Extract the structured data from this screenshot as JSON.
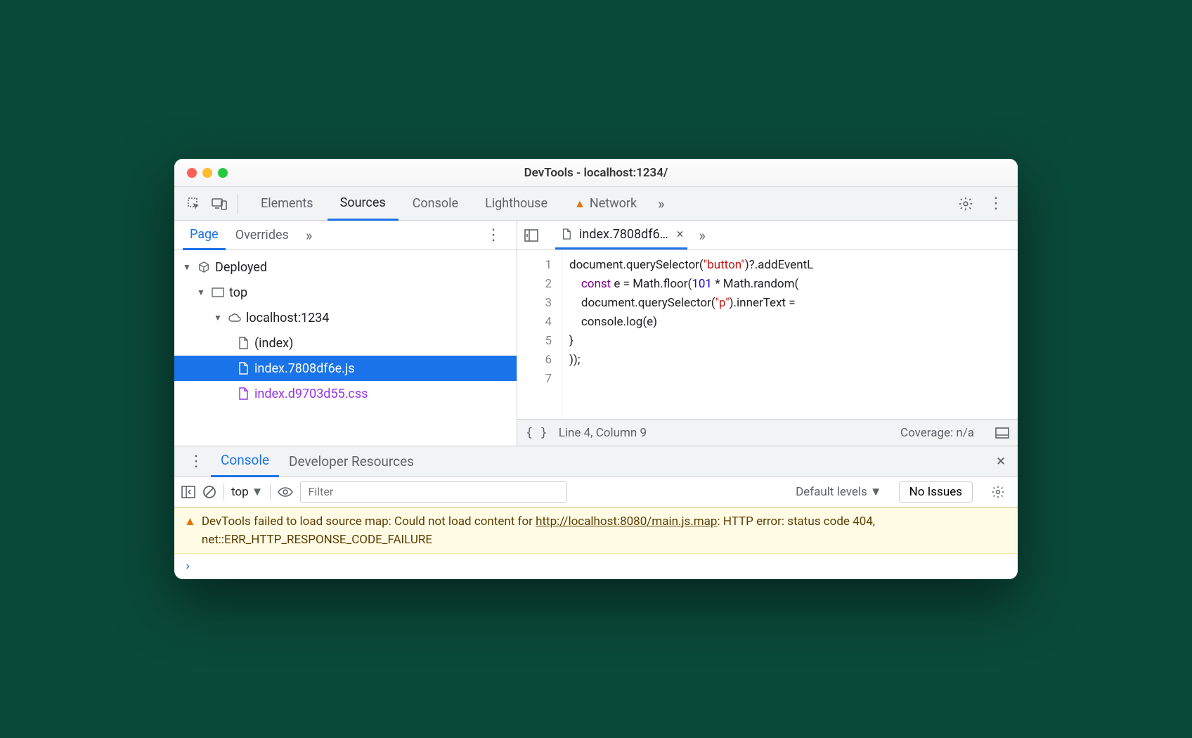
{
  "window": {
    "title": "DevTools - localhost:1234/"
  },
  "toolbar": {
    "tabs": [
      "Elements",
      "Sources",
      "Console",
      "Lighthouse",
      "Network"
    ],
    "active_tab": "Sources"
  },
  "navigator": {
    "tabs": [
      "Page",
      "Overrides"
    ],
    "active": "Page",
    "tree": {
      "root": "Deployed",
      "top": "top",
      "origin": "localhost:1234",
      "files": [
        {
          "name": "(index)",
          "type": "doc",
          "selected": false
        },
        {
          "name": "index.7808df6e.js",
          "type": "js",
          "selected": true
        },
        {
          "name": "index.d9703d55.css",
          "type": "css",
          "selected": false
        }
      ]
    }
  },
  "editor": {
    "open_file": "index.7808df6…",
    "line_count": 7,
    "lines": [
      "document.querySelector(\"button\")?.addEventL",
      "    const e = Math.floor(101 * Math.random(",
      "    document.querySelector(\"p\").innerText =",
      "    console.log(e)",
      "}",
      "));",
      ""
    ],
    "status_left": "Line 4, Column 9",
    "status_right": "Coverage: n/a"
  },
  "drawer": {
    "tabs": [
      "Console",
      "Developer Resources"
    ],
    "active": "Console"
  },
  "console": {
    "context": "top",
    "filter_placeholder": "Filter",
    "levels": "Default levels",
    "issues": "No Issues",
    "warning": {
      "prefix": "DevTools failed to load source map: Could not load content for ",
      "link": "http://localhost:8080/main.js.map",
      "suffix": ": HTTP error: status code 404, net::ERR_HTTP_RESPONSE_CODE_FAILURE"
    }
  }
}
